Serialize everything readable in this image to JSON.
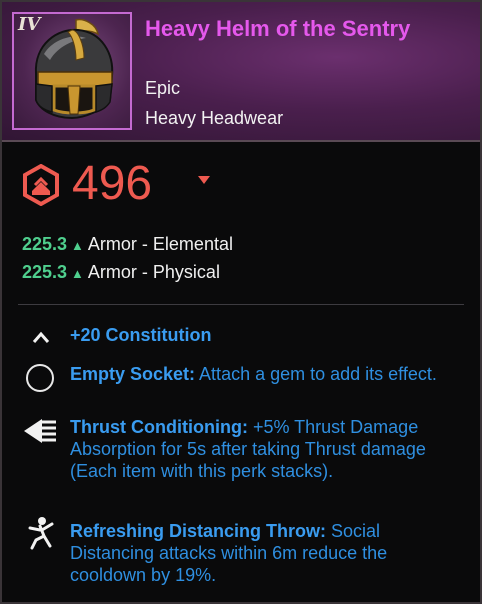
{
  "item": {
    "tier": "IV",
    "name": "Heavy Helm of the Sentry",
    "rarity": "Epic",
    "type": "Heavy Headwear",
    "gear_score": "496"
  },
  "stats": [
    {
      "value": "225.3",
      "label": "Armor - Elemental"
    },
    {
      "value": "225.3",
      "label": "Armor - Physical"
    }
  ],
  "perks": {
    "attribute": "+20 Constitution",
    "socket": {
      "name": "Empty Socket:",
      "desc": " Attach a gem to add its effect."
    },
    "thrust": {
      "name": "Thrust Conditioning:",
      "desc": " +5% Thrust Damage Absorption for 5s after taking Thrust damage (Each item with this perk stacks)."
    },
    "throw": {
      "name": "Refreshing Distancing Throw:",
      "desc": " Social Distancing attacks within 6m reduce the cooldown by 19%."
    }
  },
  "colors": {
    "title": "#e558ec",
    "gear_score": "#ee5a50",
    "stat_value": "#4fcf8e",
    "perk_text": "#2f8fe0"
  }
}
